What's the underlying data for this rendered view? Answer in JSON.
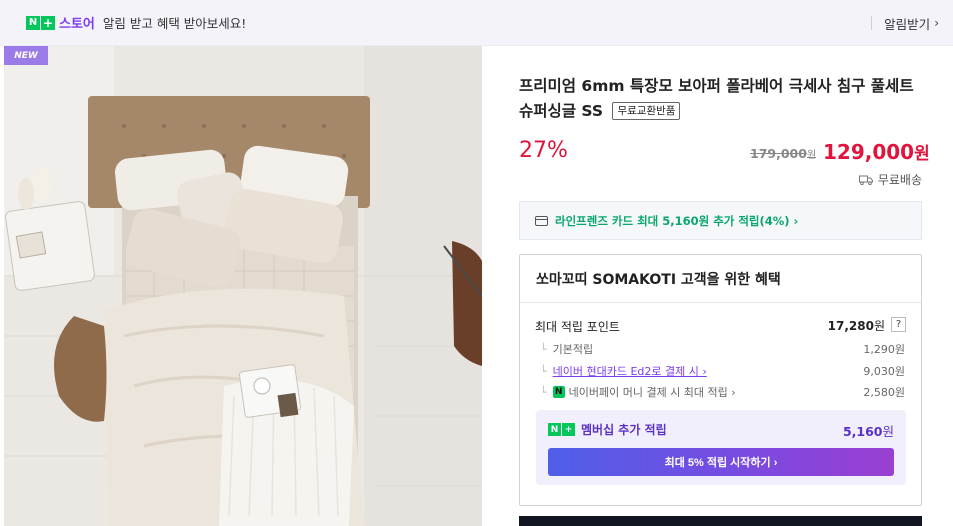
{
  "banner": {
    "logo_text": "스토어",
    "logo_n": "N",
    "logo_plus": "+",
    "message": "알림 받고 혜택 받아보세요!",
    "alarm_button": "알림받기",
    "alarm_chevron": "›"
  },
  "product": {
    "badge": "NEW",
    "title": "프리미엄 6mm 특장모 보아퍼 폴라베어 극세사 침구 풀세트 슈퍼싱글 SS",
    "return_tag": "무료교환반품",
    "discount": "27%",
    "original_price": "179,000",
    "original_price_unit": "원",
    "sale_price": "129,000",
    "sale_price_unit": "원",
    "shipping": "무료배송"
  },
  "card_promo": {
    "text": "라인프렌즈 카드 최대 5,160원 추가 적립(4%) ›"
  },
  "benefits": {
    "title": "쏘마꼬띠 SOMAKOTI 고객을 위한 혜택",
    "max_label": "최대 적립 포인트",
    "max_value": "17,280",
    "max_unit": "원",
    "help": "?",
    "items": [
      {
        "label": "기본적립",
        "value": "1,290원"
      },
      {
        "label": "네이버 현대카드 Ed2로 결제 시 ›",
        "value": "9,030원"
      },
      {
        "label": "네이버페이 머니 결제 시 최대 적립 ›",
        "value": "2,580원"
      }
    ],
    "membership": {
      "label": "멤버십 추가 적립",
      "value": "5,160",
      "unit": "원",
      "button": "최대 5% 적립 시작하기 ›"
    }
  },
  "colors": {
    "accent_red": "#e0143c",
    "naver_green": "#03c75a",
    "purple": "#7b3df0"
  }
}
